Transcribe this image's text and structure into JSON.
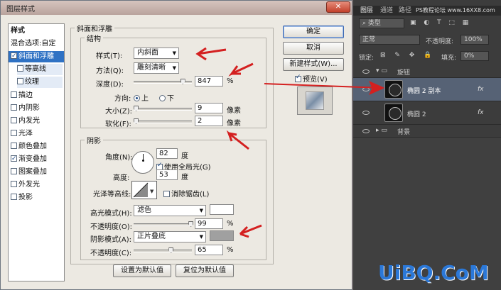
{
  "dialog": {
    "title": "图层样式",
    "close": "✕",
    "styles_header": "样式",
    "blend_options": "混合选项:自定",
    "items": [
      {
        "label": "斜面和浮雕",
        "checked": true
      },
      {
        "label": "等高线",
        "checked": false
      },
      {
        "label": "纹理",
        "checked": false
      },
      {
        "label": "描边",
        "checked": false
      },
      {
        "label": "内阴影",
        "checked": false
      },
      {
        "label": "内发光",
        "checked": false
      },
      {
        "label": "光泽",
        "checked": false
      },
      {
        "label": "颜色叠加",
        "checked": false
      },
      {
        "label": "渐变叠加",
        "checked": true
      },
      {
        "label": "图案叠加",
        "checked": false
      },
      {
        "label": "外发光",
        "checked": false
      },
      {
        "label": "投影",
        "checked": false
      }
    ],
    "bevel": {
      "section": "斜面和浮雕",
      "structure": "结构",
      "style_label": "样式(T):",
      "style_value": "内斜面",
      "method_label": "方法(Q):",
      "method_value": "雕刻清晰",
      "depth_label": "深度(D):",
      "depth_value": "847",
      "depth_unit": "%",
      "depth_level": 0.85,
      "direction_label": "方向:",
      "dir_up": "上",
      "dir_down": "下",
      "size_label": "大小(Z):",
      "size_value": "9",
      "size_unit": "像素",
      "size_level": 0.05,
      "soften_label": "软化(F):",
      "soften_value": "2",
      "soften_unit": "像素",
      "soften_level": 0.05
    },
    "shading": {
      "section": "阴影",
      "angle_label": "角度(N):",
      "angle_value": "82",
      "angle_unit": "度",
      "global_light": "使用全局光(G)",
      "altitude_label": "高度:",
      "altitude_value": "53",
      "altitude_unit": "度",
      "gloss_label": "光泽等高线:",
      "antialias": "消除锯齿(L)",
      "hl_mode_label": "高光模式(H):",
      "hl_mode_value": "滤色",
      "hl_opacity_label": "不透明度(O):",
      "hl_opacity_value": "99",
      "hl_opacity_level": 0.99,
      "sh_mode_label": "阴影模式(A):",
      "sh_mode_value": "正片叠底",
      "sh_opacity_label": "不透明度(C):",
      "sh_opacity_value": "65",
      "sh_opacity_level": 0.65,
      "pct": "%",
      "hl_color": "#ffffff",
      "sh_color": "#a0a0a0"
    },
    "buttons": {
      "ok": "确定",
      "cancel": "取消",
      "new_style": "新建样式(W)...",
      "preview": "预览(V)",
      "set_default": "设置为默认值",
      "reset_default": "复位为默认值"
    }
  },
  "layers": {
    "tabs": [
      "图层",
      "通道",
      "路径"
    ],
    "watermark_top": "PS教程论坛 www.16XX8.com",
    "kind": "类型",
    "blend": "正常",
    "opacity_label": "不透明度:",
    "opacity_value": "100%",
    "lock_label": "锁定:",
    "fill_label": "填充:",
    "fill_value": "0%",
    "rows": [
      {
        "name": "旋钮",
        "type": "group-open"
      },
      {
        "name": "椭圆 2 副本",
        "type": "layer",
        "fx": "fx"
      },
      {
        "name": "椭圆 2",
        "type": "layer",
        "fx": "fx"
      },
      {
        "name": "背景",
        "type": "group-closed"
      }
    ]
  },
  "watermark": "UiBQ.CoM"
}
